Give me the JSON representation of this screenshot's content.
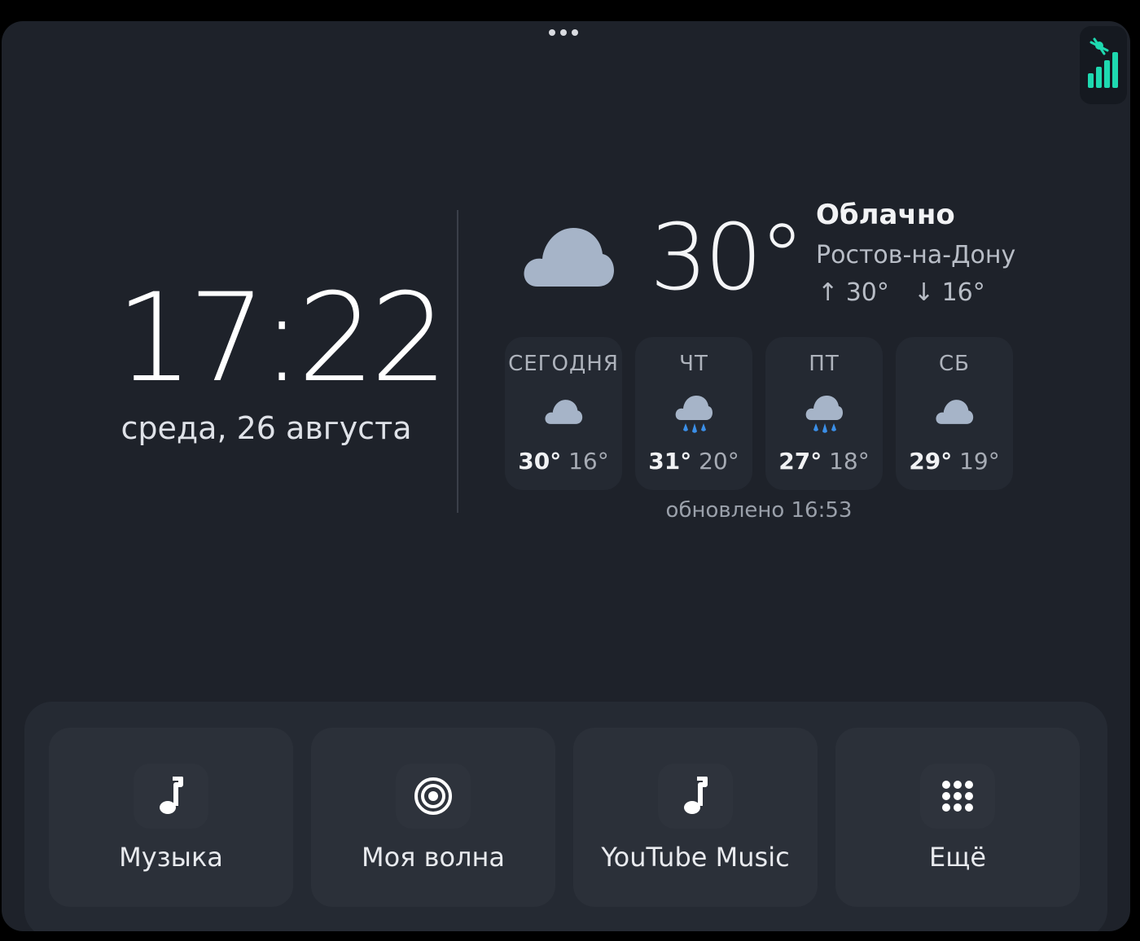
{
  "clock": {
    "time": "17:22",
    "date": "среда, 26 августа"
  },
  "weather": {
    "current_icon": "cloud-icon",
    "temperature": "30°",
    "condition": "Облачно",
    "city": "Ростов-на-Дону",
    "high_arrow": "↑",
    "high": "30°",
    "low_arrow": "↓",
    "low": "16°",
    "forecast": [
      {
        "day": "СЕГОДНЯ",
        "icon": "cloud-icon",
        "hi": "30°",
        "lo": "16°"
      },
      {
        "day": "ЧТ",
        "icon": "cloud-rain-icon",
        "hi": "31°",
        "lo": "20°"
      },
      {
        "day": "ПТ",
        "icon": "cloud-rain-icon",
        "hi": "27°",
        "lo": "18°"
      },
      {
        "day": "СБ",
        "icon": "cloud-icon",
        "hi": "29°",
        "lo": "19°"
      }
    ],
    "updated": "обновлено 16:53"
  },
  "status": {
    "signal_icon": "signal-bars-icon"
  },
  "dock": {
    "tiles": [
      {
        "label": "Музыка",
        "icon": "music-note-icon"
      },
      {
        "label": "Моя волна",
        "icon": "radio-wave-icon"
      },
      {
        "label": "YouTube Music",
        "icon": "music-note-icon"
      },
      {
        "label": "Ещё",
        "icon": "apps-grid-icon"
      }
    ]
  },
  "colors": {
    "background": "#1e222a",
    "card": "#242932",
    "cloud": "#a6b4c8",
    "rain": "#3b8fe8",
    "signal": "#1ed9b0"
  }
}
